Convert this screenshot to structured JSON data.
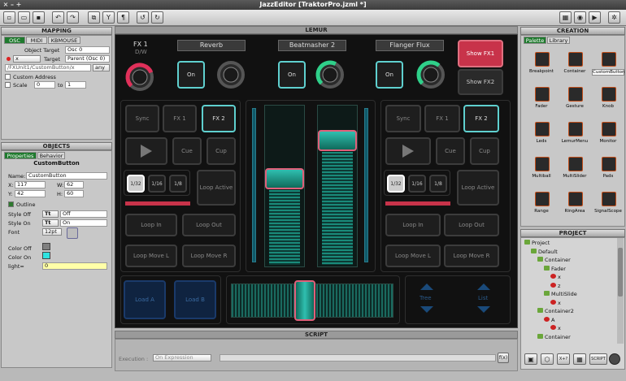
{
  "window": {
    "title": "JazzEditor [TraktorPro.jzml *]"
  },
  "mapping": {
    "title": "MAPPING",
    "tabs": [
      "OSC",
      "MIDI",
      "KBMOUSE"
    ],
    "object_target_label": "Object Target",
    "object_target": "Osc 0",
    "x_value": "x",
    "target_label": "Target",
    "target": "Parent (Osc 0)",
    "path": "/FXUnit1/CustomButton/x",
    "any": "any",
    "custom_address": "Custom Address",
    "scale_label": "Scale",
    "scale_from": "0",
    "scale_to_label": "to",
    "scale_to": "1"
  },
  "objects": {
    "title": "OBJECTS",
    "tabs": [
      "Properties",
      "Behavior"
    ],
    "heading": "CustomButton",
    "name_label": "Name:",
    "name": "CustomButton",
    "x_label": "X:",
    "x": "117",
    "w_label": "W:",
    "w": "62",
    "y_label": "Y:",
    "y": "42",
    "h_label": "H:",
    "h": "60",
    "outline": "Outline",
    "style_off_label": "Style Off",
    "style_off": "Off",
    "style_on_label": "Style On",
    "style_on": "On",
    "tt": "Tt",
    "font_label": "Font",
    "font": "12pt",
    "color_off_label": "Color Off",
    "color_on_label": "Color On",
    "light_label": "light=",
    "light": "0",
    "color_off": "#808080",
    "color_on": "#2fe3e0"
  },
  "lemur": {
    "title": "LEMUR",
    "fx_label": "FX 1",
    "dw_label": "D/W",
    "fx_names": [
      "Reverb",
      "Beatmasher 2",
      "Flanger Flux"
    ],
    "on": "On",
    "show_fx1": "Show FX1",
    "show_fx2": "Show FX2",
    "sync": "Sync",
    "fx1": "FX 1",
    "fx2": "FX 2",
    "cue": "Cue",
    "cup": "Cup",
    "loops": [
      "1/32",
      "1/16",
      "1/8"
    ],
    "loop_active": "Loop Active",
    "loop_in": "Loop In",
    "loop_out": "Loop Out",
    "loop_move_l": "Loop Move L",
    "loop_move_r": "Loop Move R",
    "load_a": "Load A",
    "load_b": "Load B",
    "tree": "Tree",
    "list": "List",
    "knobs": [
      {
        "value": 0.75,
        "color": "#e0305a"
      },
      {
        "value": 0.0,
        "color": "#7a7a7a"
      },
      {
        "value": 0.6,
        "color": "#2fd08a"
      },
      {
        "value": 0.0,
        "color": "#7a7a7a"
      },
      {
        "value": 0.65,
        "color": "#2fd08a"
      }
    ],
    "faders": [
      {
        "value": 0.55
      },
      {
        "value": 0.82
      }
    ],
    "crossfader": 0.45
  },
  "script": {
    "title": "SCRIPT",
    "execution_label": "Execution :",
    "execution": "On Expression",
    "fx": "f(x)"
  },
  "creation": {
    "title": "CREATION",
    "tabs": [
      "Palette",
      "Library"
    ],
    "items": [
      "Breakpoint",
      "Container",
      "CustomButton",
      "Fader",
      "Gesture",
      "Knob",
      "Leds",
      "LemurMenu",
      "Monitor",
      "Multiball",
      "MultiSlider",
      "Pads",
      "Range",
      "RingArea",
      "SignalScope"
    ],
    "selected": "CustomButton"
  },
  "project": {
    "title": "PROJECT",
    "tree": [
      "Project",
      "Default",
      "Container",
      "Fader",
      "x",
      "z",
      "MultiSlide",
      "x",
      "Container2",
      "A",
      "x",
      "Container"
    ],
    "bottom_buttons": [
      "X+?",
      "SCRIPT"
    ]
  }
}
